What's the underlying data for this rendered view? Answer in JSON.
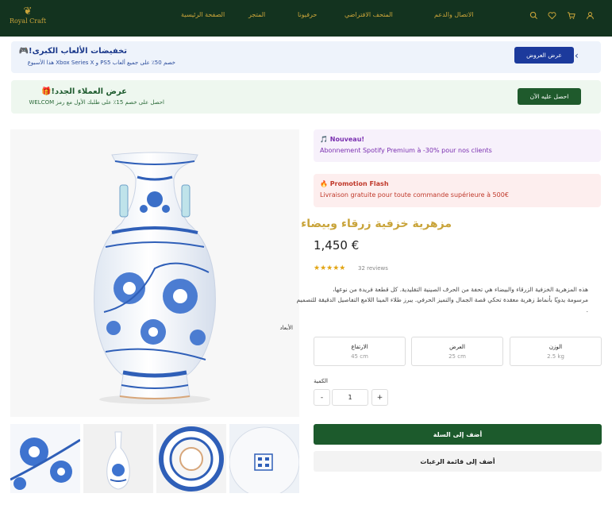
{
  "header": {
    "logo_text": "Royal Craft",
    "nav": [
      {
        "label": "الصفحة الرئيسية"
      },
      {
        "label": "المتجر"
      },
      {
        "label": "حرفيونا"
      },
      {
        "label": "المتحف الافتراضي"
      },
      {
        "label": "الاتصال والدعم"
      }
    ],
    "icons": [
      "search-icon",
      "heart-icon",
      "cart-icon",
      "user-icon"
    ],
    "background": "#13331f",
    "accent": "#c9a43a"
  },
  "promo_banners": [
    {
      "title": "تخفيضات الألعاب الكبرى!🎮",
      "subtitle": "خصم 50٪ على جميع ألعاب PS5 و Xbox Series X هذا الأسبوع",
      "button": "عرض العروض"
    },
    {
      "title": "عرض العملاء الجدد!🎁",
      "subtitle": "احصل على خصم 15٪ على طلبك الأول مع رمز WELCOM",
      "button": "احصل عليه الآن"
    }
  ],
  "notices": [
    {
      "icon": "🎵",
      "title": "Nouveau!",
      "text": "Abonnement Spotify Premium à -30% pour nos clients"
    },
    {
      "icon": "🔥",
      "title": "Promotion Flash",
      "text": "Livraison gratuite pour toute commande supérieure à 500€"
    }
  ],
  "product": {
    "title": "مزهرية خزفية زرقاء وبيضاء",
    "price": "1,450 €",
    "rating": 4.5,
    "stars": "★★★★★",
    "reviews": "32 reviews",
    "description_line1": "هذه المزهرية الخزفية الزرقاء والبيضاء هي تحفة من الحرف الصينية التقليدية. كل قطعة فريدة من نوعها،",
    "description_line2": "مرسومة يدويًا بأنماط زهرية معقدة تحكي قصة الجمال والتميز الحرفي. يبرز طلاء المينا اللامع التفاصيل الدقيقة للتصميم",
    "description_line3": ".",
    "dimensions_label": "الأبعاد",
    "dimensions": [
      {
        "label": "الارتفاع",
        "value": "45 cm"
      },
      {
        "label": "العرض",
        "value": "25 cm"
      },
      {
        "label": "الوزن",
        "value": "2.5 kg"
      }
    ],
    "quantity_label": "الكمية",
    "quantity": "1",
    "minus": "-",
    "plus": "+",
    "add_to_cart": "أضف إلى السلة",
    "add_to_wishlist": "أضف إلى قائمة الرغبات"
  },
  "colors": {
    "primary_green": "#1c5a2c",
    "vase_blue": "#2f5fb8",
    "gold": "#c9a43a"
  }
}
